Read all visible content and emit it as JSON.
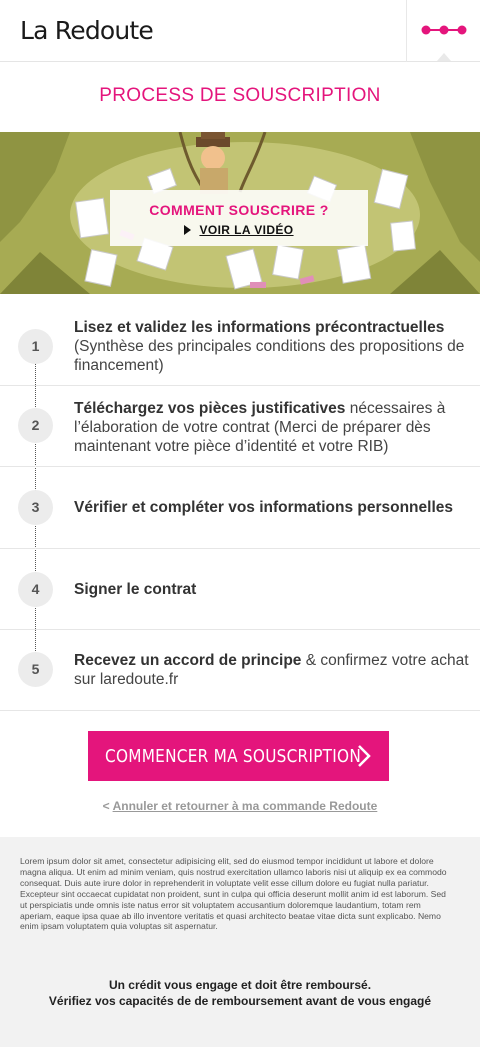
{
  "header": {
    "logo_text": "La Redoute",
    "menu_icon": "dots-menu-icon",
    "accent_color": "#e4157c"
  },
  "page": {
    "title": "PROCESS DE SOUSCRIPTION"
  },
  "hero": {
    "cta_title": "COMMENT SOUSCRIRE ?",
    "cta_link": "VOIR LA VIDÉO",
    "play_icon": "play-icon"
  },
  "steps": [
    {
      "number": "1",
      "bold": "Lisez et validez les informations précontractuelles",
      "rest": " (Synthèse des principales conditions des propositions de financement)"
    },
    {
      "number": "2",
      "bold": "Téléchargez vos pièces justificatives",
      "rest": " nécessaires à l’élaboration de votre contrat (Merci de préparer dès maintenant votre pièce d’identité et votre RIB)"
    },
    {
      "number": "3",
      "bold": "Vérifier et compléter vos informations personnelles",
      "rest": ""
    },
    {
      "number": "4",
      "bold": "Signer le contrat",
      "rest": ""
    },
    {
      "number": "5",
      "bold": "Recevez un accord de principe",
      "rest": " & confirmez votre achat sur laredoute.fr"
    }
  ],
  "actions": {
    "start_button": "COMMENCER MA SOUSCRIPTION",
    "cancel_prefix": "< ",
    "cancel_link": "Annuler et retourner à ma commande Redoute"
  },
  "footer": {
    "lorem": "Lorem ipsum dolor sit amet, consectetur adipisicing elit, sed do eiusmod tempor incididunt ut labore et dolore magna aliqua. Ut enim ad minim veniam, quis nostrud exercitation ullamco laboris nisi ut aliquip ex ea commodo consequat. Duis aute irure dolor in reprehenderit in voluptate velit esse cillum dolore eu fugiat nulla pariatur. Excepteur sint occaecat cupidatat non proident, sunt in culpa qui officia deserunt mollit anim id est laborum. Sed ut perspiciatis unde omnis iste natus error sit voluptatem accusantium doloremque laudantium, totam rem aperiam, eaque ipsa quae ab illo inventore veritatis et quasi architecto beatae vitae dicta sunt explicabo. Nemo enim ipsam voluptatem quia voluptas sit aspernatur.",
    "warning_line1": "Un crédit vous engage et doit être remboursé.",
    "warning_line2": "Vérifiez vos capacités de de remboursement avant de vous engagé"
  }
}
